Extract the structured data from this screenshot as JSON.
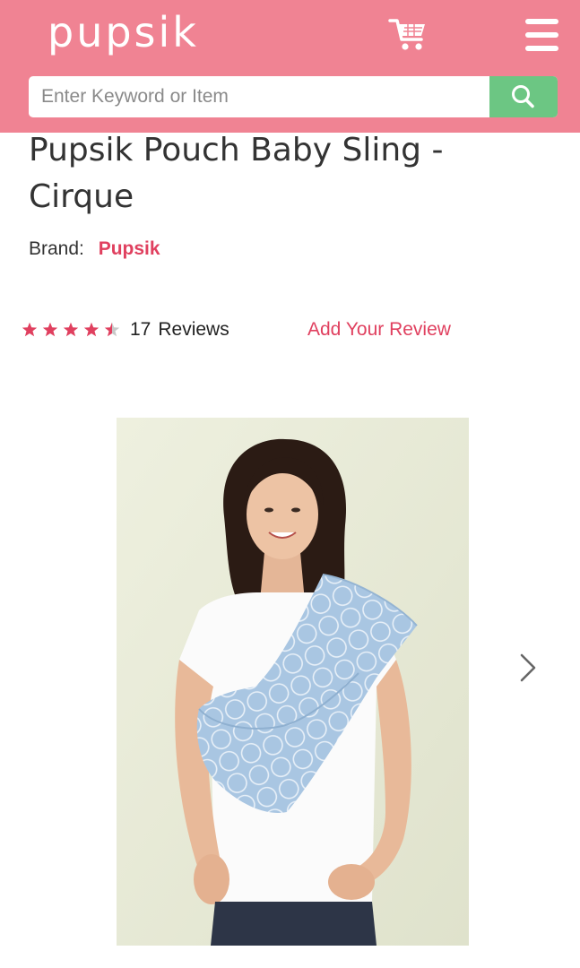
{
  "header": {
    "logo_text": "pupsik",
    "bg_color": "#f08393",
    "cart_icon": "shopping-cart-icon",
    "menu_icon": "hamburger-menu-icon"
  },
  "search": {
    "placeholder": "Enter Keyword or Item",
    "value": "",
    "button_icon": "search-icon",
    "button_color": "#6cc683"
  },
  "product": {
    "title": "Pupsik Pouch Baby Sling - Cirque",
    "brand_label": "Brand:",
    "brand_name": "Pupsik",
    "rating": 4.5,
    "rating_max": 5,
    "review_count": "17",
    "review_label": "Reviews",
    "add_review_label": "Add Your Review",
    "image_alt": "Woman wearing a light blue circle-pattern pouch baby sling",
    "next_icon": "chevron-right-icon"
  },
  "colors": {
    "accent": "#e0405f",
    "star_filled": "#e0405f",
    "star_empty": "#c8c8c8"
  }
}
